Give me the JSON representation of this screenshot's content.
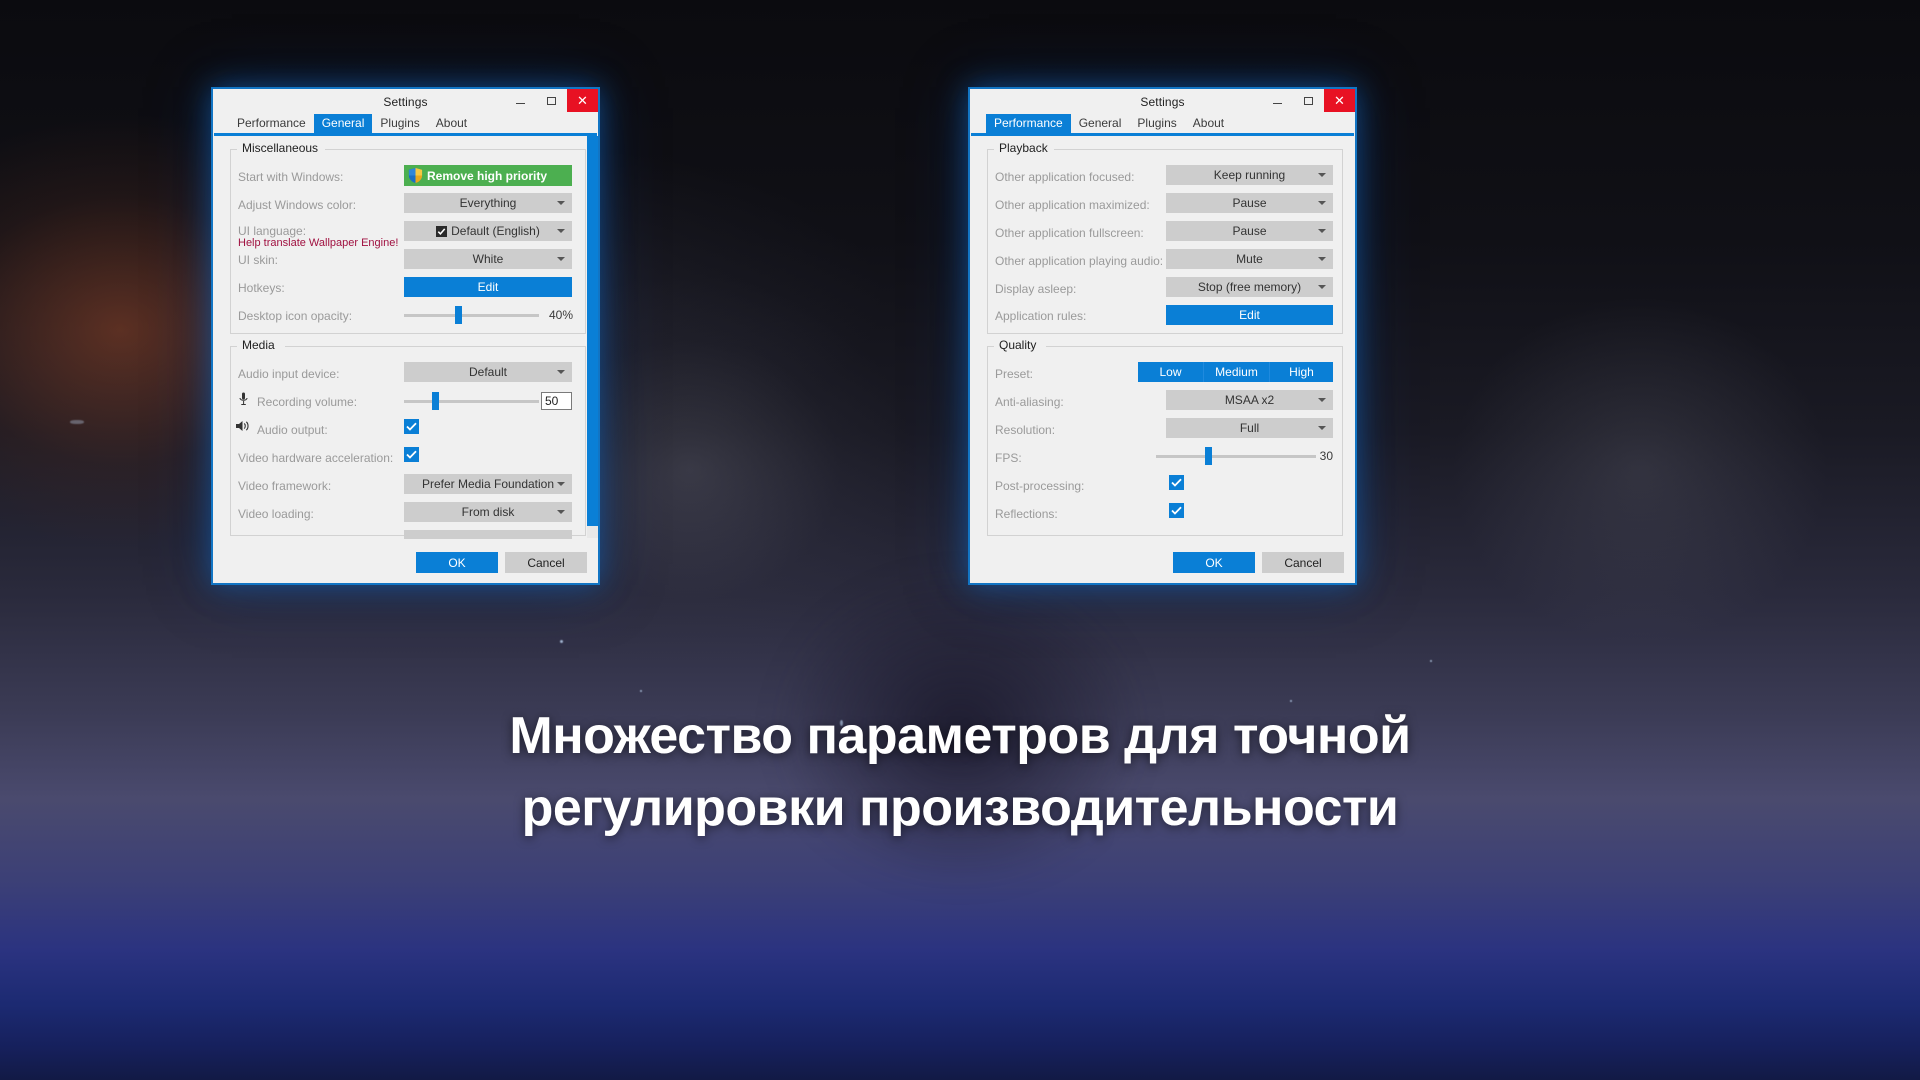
{
  "caption": {
    "line1": "Множество параметров для точной",
    "line2": "регулировки производительности"
  },
  "left_dialog": {
    "title": "Settings",
    "window_buttons": {
      "minimize": "–",
      "maximize": "□",
      "close": "✕"
    },
    "tabs": [
      {
        "label": "Performance",
        "active": false
      },
      {
        "label": "General",
        "active": true
      },
      {
        "label": "Plugins",
        "active": false
      },
      {
        "label": "About",
        "active": false
      }
    ],
    "groups": [
      {
        "title": "Miscellaneous",
        "rows": [
          {
            "label": "Start with Windows:",
            "control": "green-button",
            "value": "Remove high priority"
          },
          {
            "label": "Adjust Windows color:",
            "control": "combo",
            "value": "Everything"
          },
          {
            "label": "UI language:",
            "sub_label": "Help translate Wallpaper Engine!",
            "control": "combo",
            "value": "Default (English)"
          },
          {
            "label": "UI skin:",
            "control": "combo",
            "value": "White"
          },
          {
            "label": "Hotkeys:",
            "control": "blue-button",
            "value": "Edit"
          },
          {
            "label": "Desktop icon opacity:",
            "control": "slider",
            "value": "40%",
            "percent": 40
          }
        ]
      },
      {
        "title": "Media",
        "rows": [
          {
            "label": "Audio input device:",
            "control": "combo",
            "value": "Default"
          },
          {
            "label": "Recording volume:",
            "icon": "microphone-icon",
            "control": "slider-number",
            "value": "50",
            "percent": 22
          },
          {
            "label": "Audio output:",
            "icon": "speaker-icon",
            "control": "checkbox",
            "checked": true
          },
          {
            "label": "Video hardware acceleration:",
            "control": "checkbox",
            "checked": true
          },
          {
            "label": "Video framework:",
            "control": "combo",
            "value": "Prefer Media Foundation"
          },
          {
            "label": "Video loading:",
            "control": "combo",
            "value": "From disk"
          }
        ]
      }
    ],
    "footer": {
      "ok": "OK",
      "cancel": "Cancel"
    }
  },
  "right_dialog": {
    "title": "Settings",
    "window_buttons": {
      "minimize": "–",
      "maximize": "□",
      "close": "✕"
    },
    "tabs": [
      {
        "label": "Performance",
        "active": true
      },
      {
        "label": "General",
        "active": false
      },
      {
        "label": "Plugins",
        "active": false
      },
      {
        "label": "About",
        "active": false
      }
    ],
    "groups": [
      {
        "title": "Playback",
        "rows": [
          {
            "label": "Other application focused:",
            "control": "combo",
            "value": "Keep running"
          },
          {
            "label": "Other application maximized:",
            "control": "combo",
            "value": "Pause"
          },
          {
            "label": "Other application fullscreen:",
            "control": "combo",
            "value": "Pause"
          },
          {
            "label": "Other application playing audio:",
            "control": "combo",
            "value": "Mute"
          },
          {
            "label": "Display asleep:",
            "control": "combo",
            "value": "Stop (free memory)"
          },
          {
            "label": "Application rules:",
            "control": "blue-button",
            "value": "Edit"
          }
        ]
      },
      {
        "title": "Quality",
        "rows": [
          {
            "label": "Preset:",
            "control": "segmented",
            "options": [
              "Low",
              "Medium",
              "High"
            ],
            "selected": "Low"
          },
          {
            "label": "Anti-aliasing:",
            "control": "combo",
            "value": "MSAA x2"
          },
          {
            "label": "Resolution:",
            "control": "combo",
            "value": "Full"
          },
          {
            "label": "FPS:",
            "control": "slider",
            "value": "30",
            "percent": 32
          },
          {
            "label": "Post-processing:",
            "control": "checkbox",
            "checked": true
          },
          {
            "label": "Reflections:",
            "control": "checkbox",
            "checked": true
          }
        ]
      }
    ],
    "footer": {
      "ok": "OK",
      "cancel": "Cancel"
    }
  },
  "colors": {
    "accent": "#0a7fd6",
    "close": "#e81123",
    "green": "#4caf50",
    "combo": "#cdcdcd",
    "label": "#9a9a9a",
    "link": "#a01040"
  }
}
